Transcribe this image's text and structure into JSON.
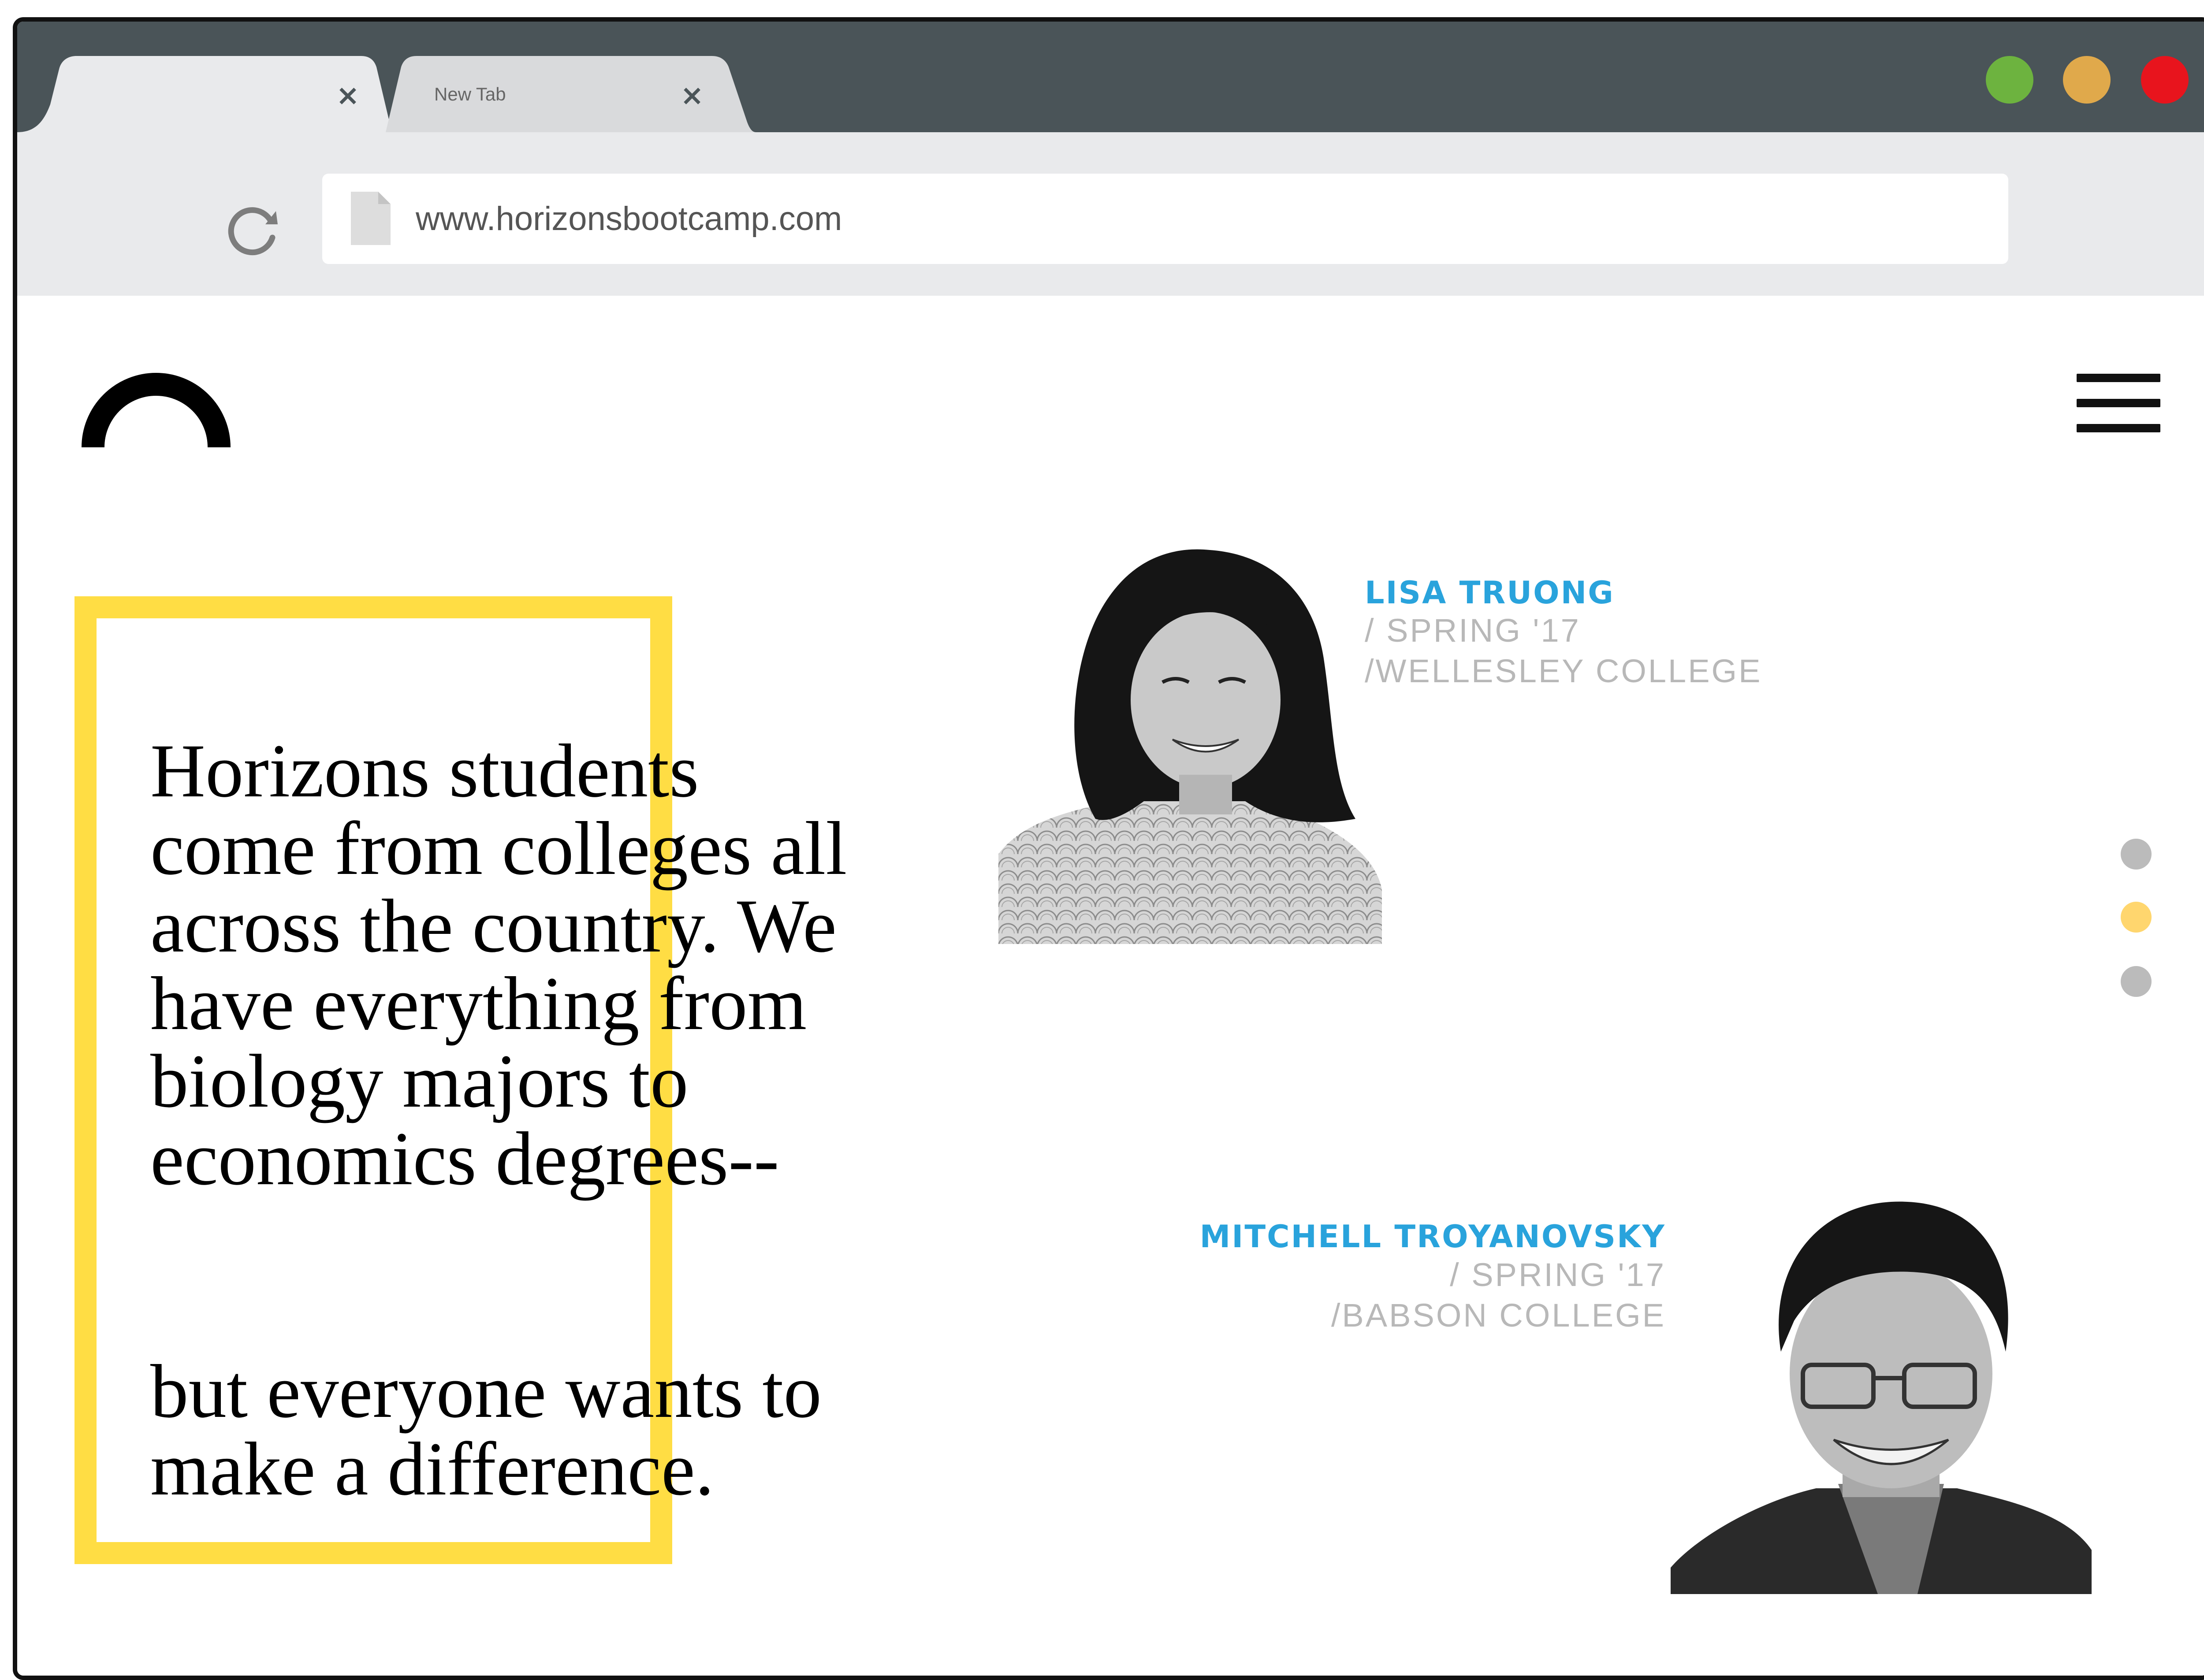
{
  "browser": {
    "tabs": [
      {
        "title": "",
        "close_label": "×",
        "active": true
      },
      {
        "title": "New Tab",
        "close_label": "×",
        "active": false
      }
    ],
    "window_buttons": {
      "maximize_color": "#6db33f",
      "minimize_color": "#e0a94b",
      "close_color": "#e8141d"
    },
    "address_bar": {
      "url": "www.horizonsbootcamp.com"
    }
  },
  "page": {
    "quote_paragraphs": [
      "Horizons students\ncome from colleges all\nacross the country. We\nhave everything from\nbiology majors to\neconomics degrees--",
      "but everyone wants to\nmake a difference."
    ],
    "students": [
      {
        "name": "LISA TRUONG",
        "term": "/ SPRING '17",
        "college": "/WELLESLEY COLLEGE"
      },
      {
        "name": "MITCHELL TROYANOVSKY",
        "term": "/ SPRING '17",
        "college": "/BABSON COLLEGE"
      }
    ],
    "carousel": {
      "count": 3,
      "active_index": 1,
      "active_color": "#ffd66e",
      "inactive_color": "#bbbbbb"
    },
    "colors": {
      "accent_yellow": "#ffdd44",
      "name_blue": "#29a3dc",
      "meta_gray": "#b8b8b8"
    }
  }
}
